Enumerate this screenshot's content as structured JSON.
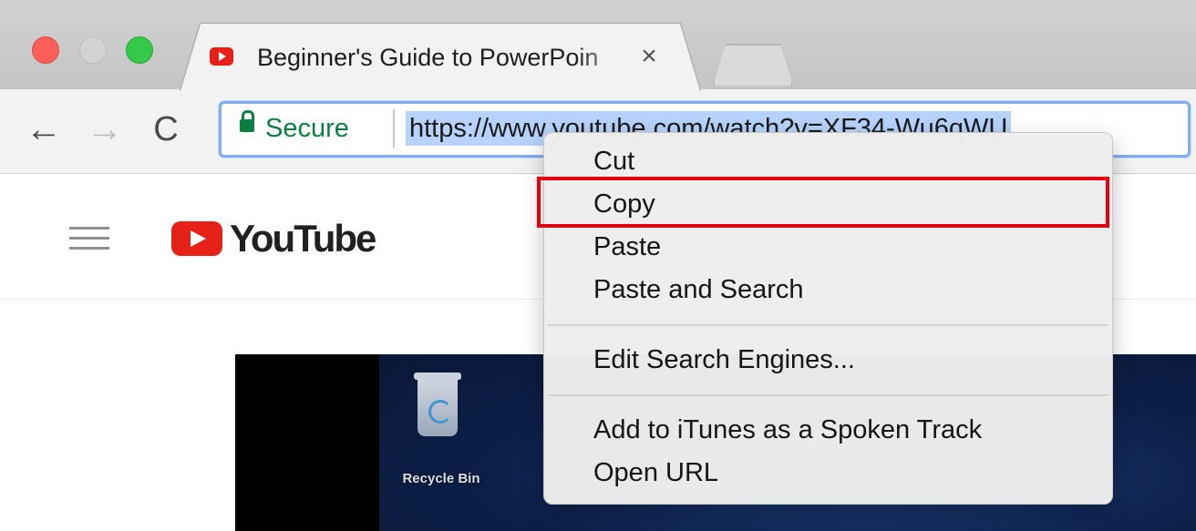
{
  "window": {
    "traffic_lights": [
      "close",
      "minimize",
      "zoom"
    ]
  },
  "tab": {
    "title": "Beginner's Guide to PowerPoin",
    "close_label": "×",
    "favicon": "youtube-favicon"
  },
  "toolbar": {
    "back_label": "←",
    "forward_label": "→",
    "reload_label": "C",
    "secure_label": "Secure",
    "url": "https://www.youtube.com/watch?v=XF34-Wu6qWU"
  },
  "youtube": {
    "logo_text": "YouTube"
  },
  "video": {
    "desktop_icon_label": "Recycle Bin"
  },
  "context_menu": {
    "items": [
      {
        "label": "Cut"
      },
      {
        "label": "Copy"
      },
      {
        "label": "Paste"
      },
      {
        "label": "Paste and Search"
      },
      {
        "label": "Edit Search Engines..."
      },
      {
        "label": "Add to iTunes as a Spoken Track"
      },
      {
        "label": "Open URL"
      }
    ],
    "highlighted_item": "Copy",
    "highlight_color": "#e4000f"
  },
  "colors": {
    "secure_green": "#0b8043",
    "youtube_red": "#e62117",
    "selection_blue": "#b7d3fb",
    "omnibox_focus": "#80aef0"
  }
}
